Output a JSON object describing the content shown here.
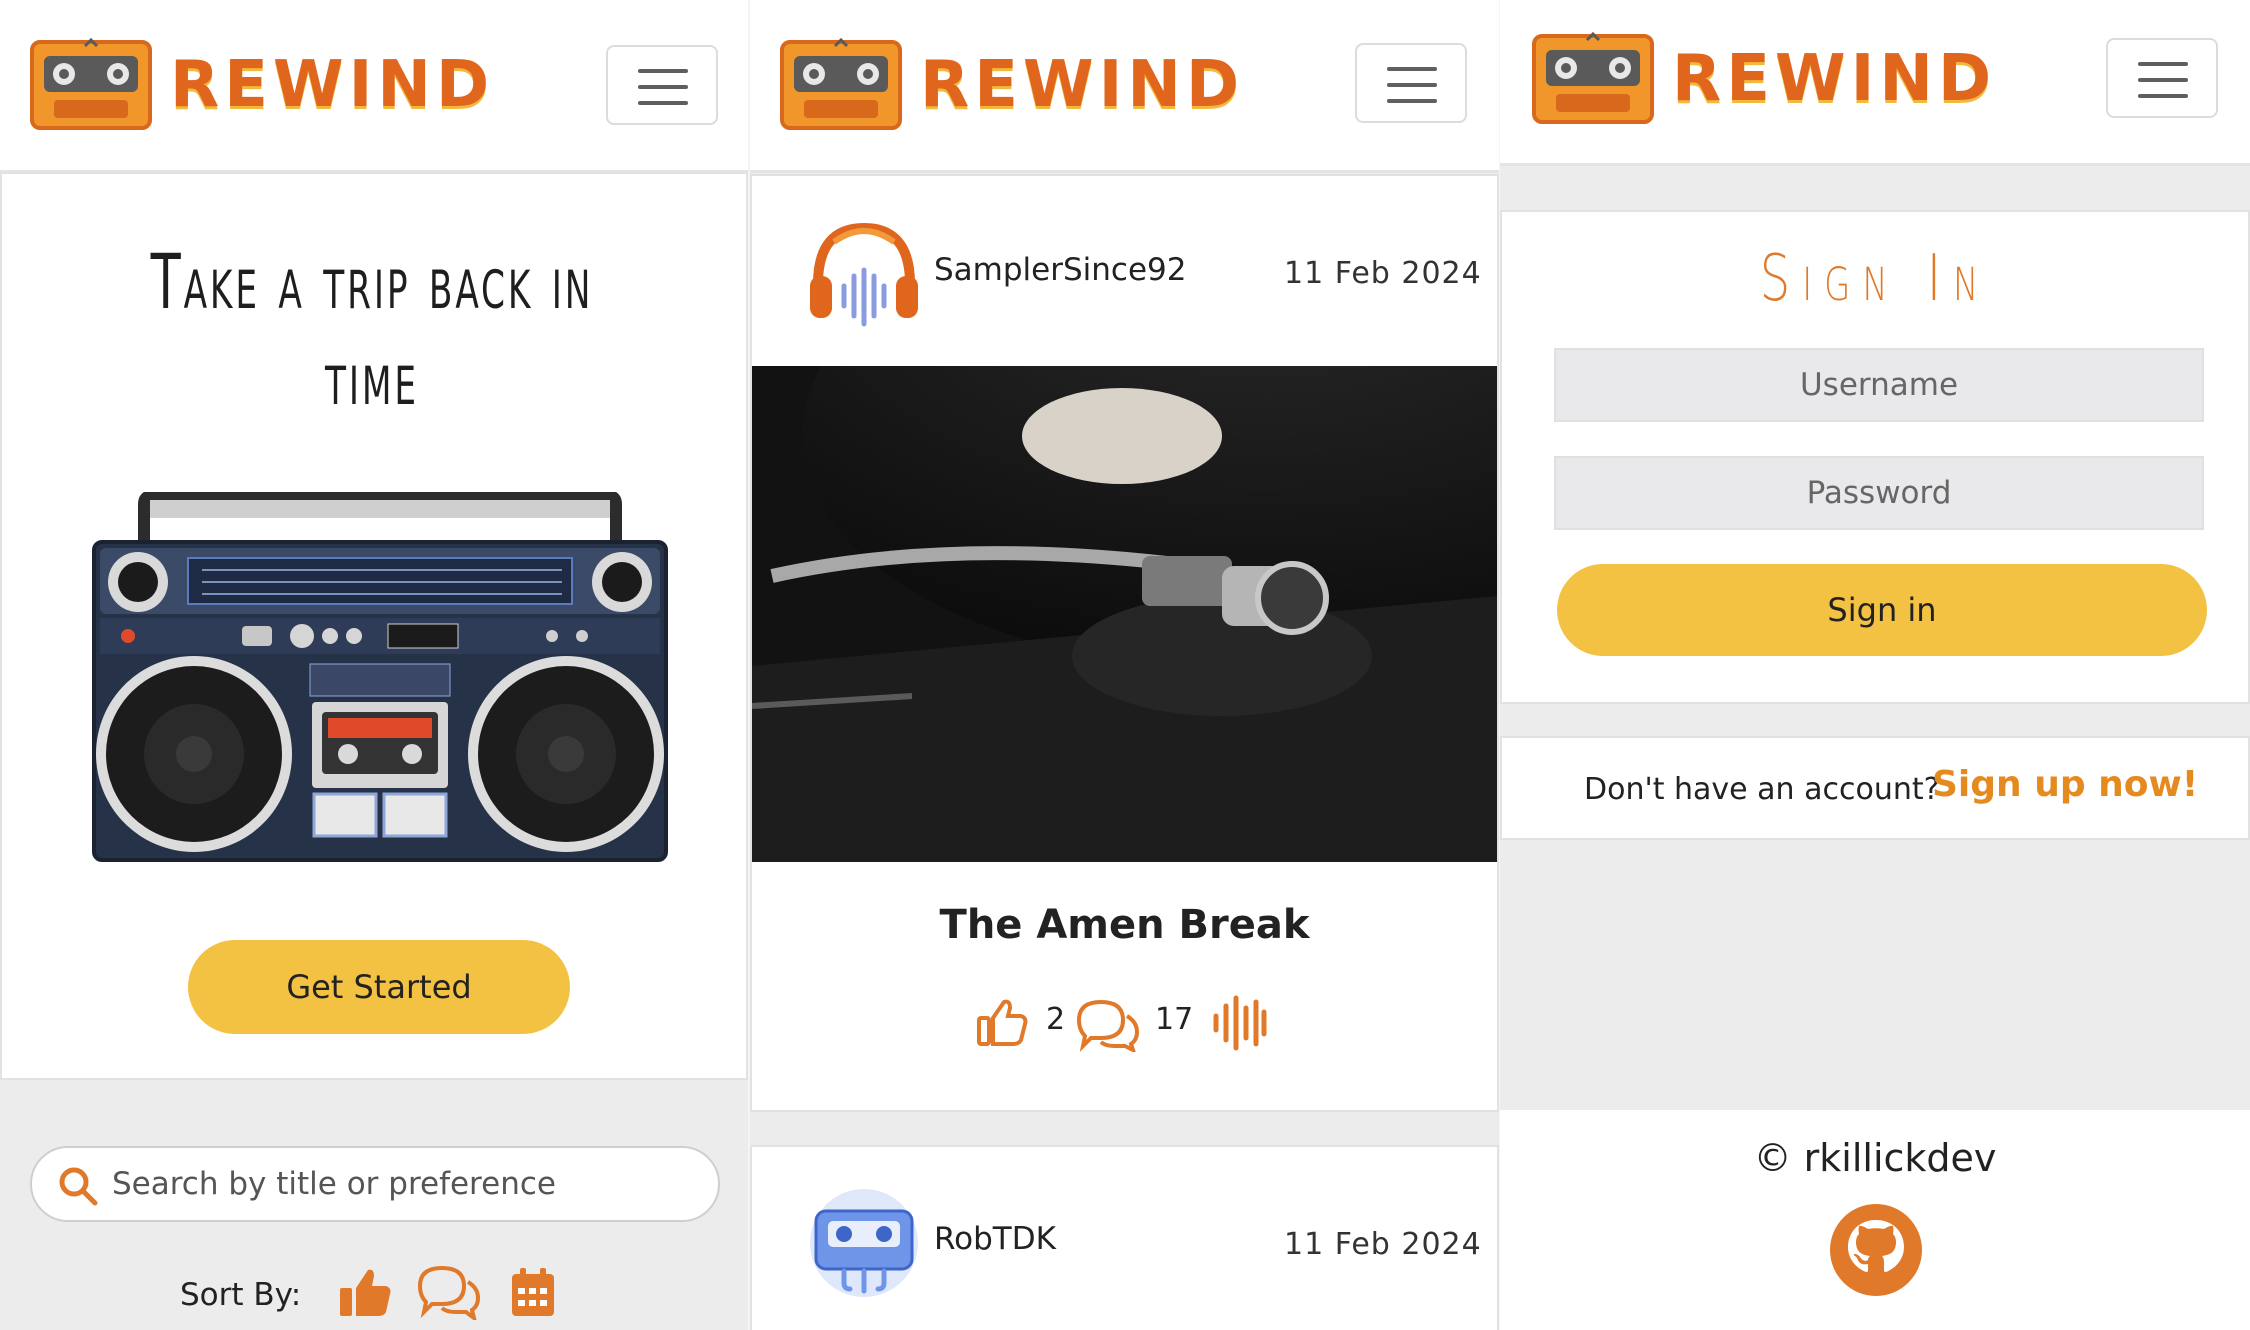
{
  "brand": {
    "name": "REWIND",
    "accent": "#e0661e",
    "button_color": "#f4c242"
  },
  "landing": {
    "hero_title": "Take a trip back in time",
    "cta_label": "Get Started",
    "search_placeholder": "Search by title or preference",
    "sort_label": "Sort By:",
    "sort_icons": [
      "thumbs-up-icon",
      "comments-icon",
      "calendar-icon"
    ]
  },
  "feed": {
    "posts": [
      {
        "user": "SamplerSince92",
        "date": "11 Feb 2024",
        "title": "The Amen Break",
        "likes": "2",
        "comments": "17"
      },
      {
        "user": "RobTDK",
        "date": "11 Feb 2024"
      }
    ]
  },
  "signin": {
    "title": "Sign In",
    "username_placeholder": "Username",
    "password_placeholder": "Password",
    "submit_label": "Sign in",
    "signup_prompt": "Don't have an account?",
    "signup_link": "Sign up now!"
  },
  "footer": {
    "copyright": "© rkillickdev",
    "icon": "github-icon"
  }
}
